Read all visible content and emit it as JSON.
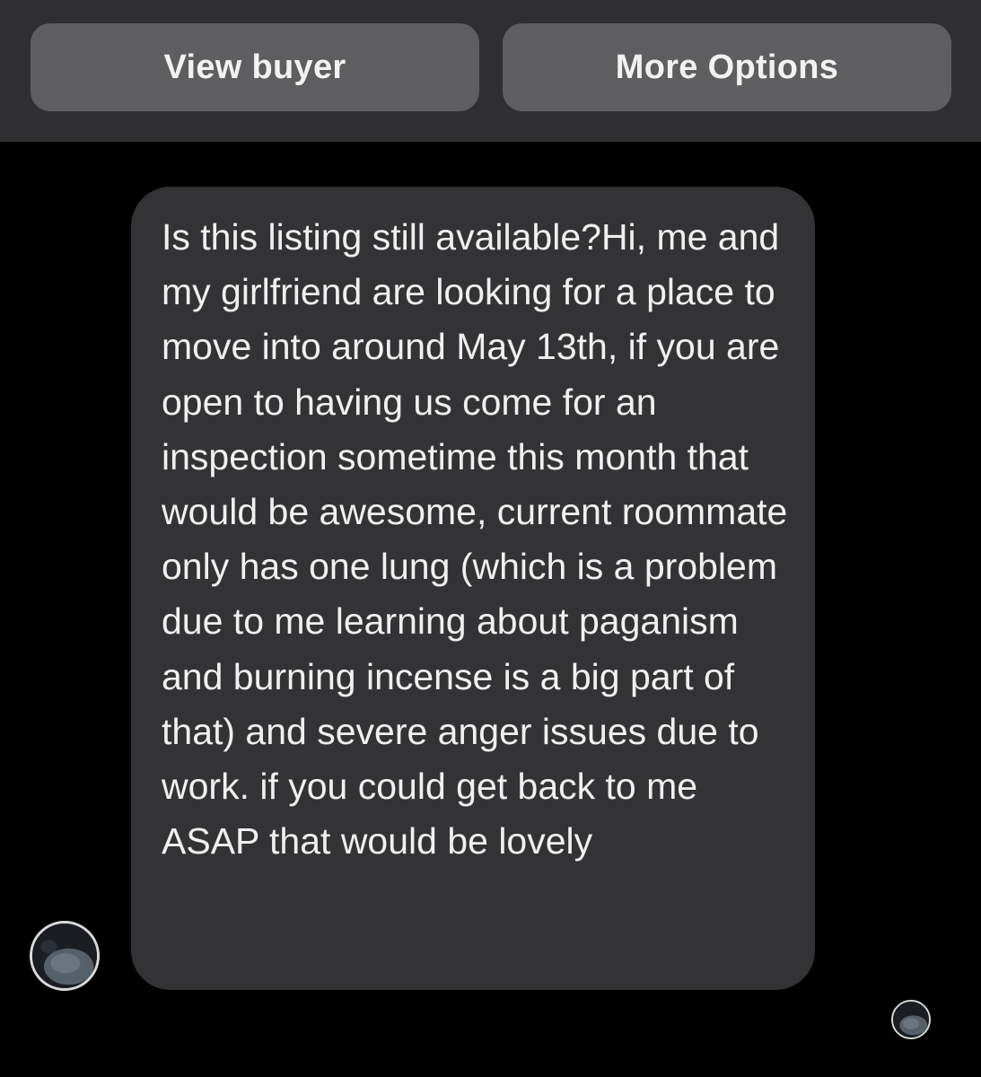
{
  "header": {
    "view_buyer_label": "View buyer",
    "more_options_label": "More Options"
  },
  "conversation": {
    "messages": [
      {
        "text": "Is this listing still available?Hi, me and my girlfriend are looking for a place to move into around May 13th, if you are open to having us come for an inspection sometime this month that would be awesome, current roommate only has one lung (which is a problem due to me learning about paganism and burning incense is a big part of that) and severe anger issues due to work. if you could get back to me ASAP that would be lovely"
      }
    ]
  },
  "icons": {
    "sender_avatar": "user-avatar-icon",
    "read_receipt_avatar": "seen-avatar-icon"
  },
  "colors": {
    "background": "#000000",
    "header_background": "#2f2f31",
    "button_background": "#5e5e60",
    "bubble_background": "#333336",
    "text": "#f0f0f0"
  }
}
